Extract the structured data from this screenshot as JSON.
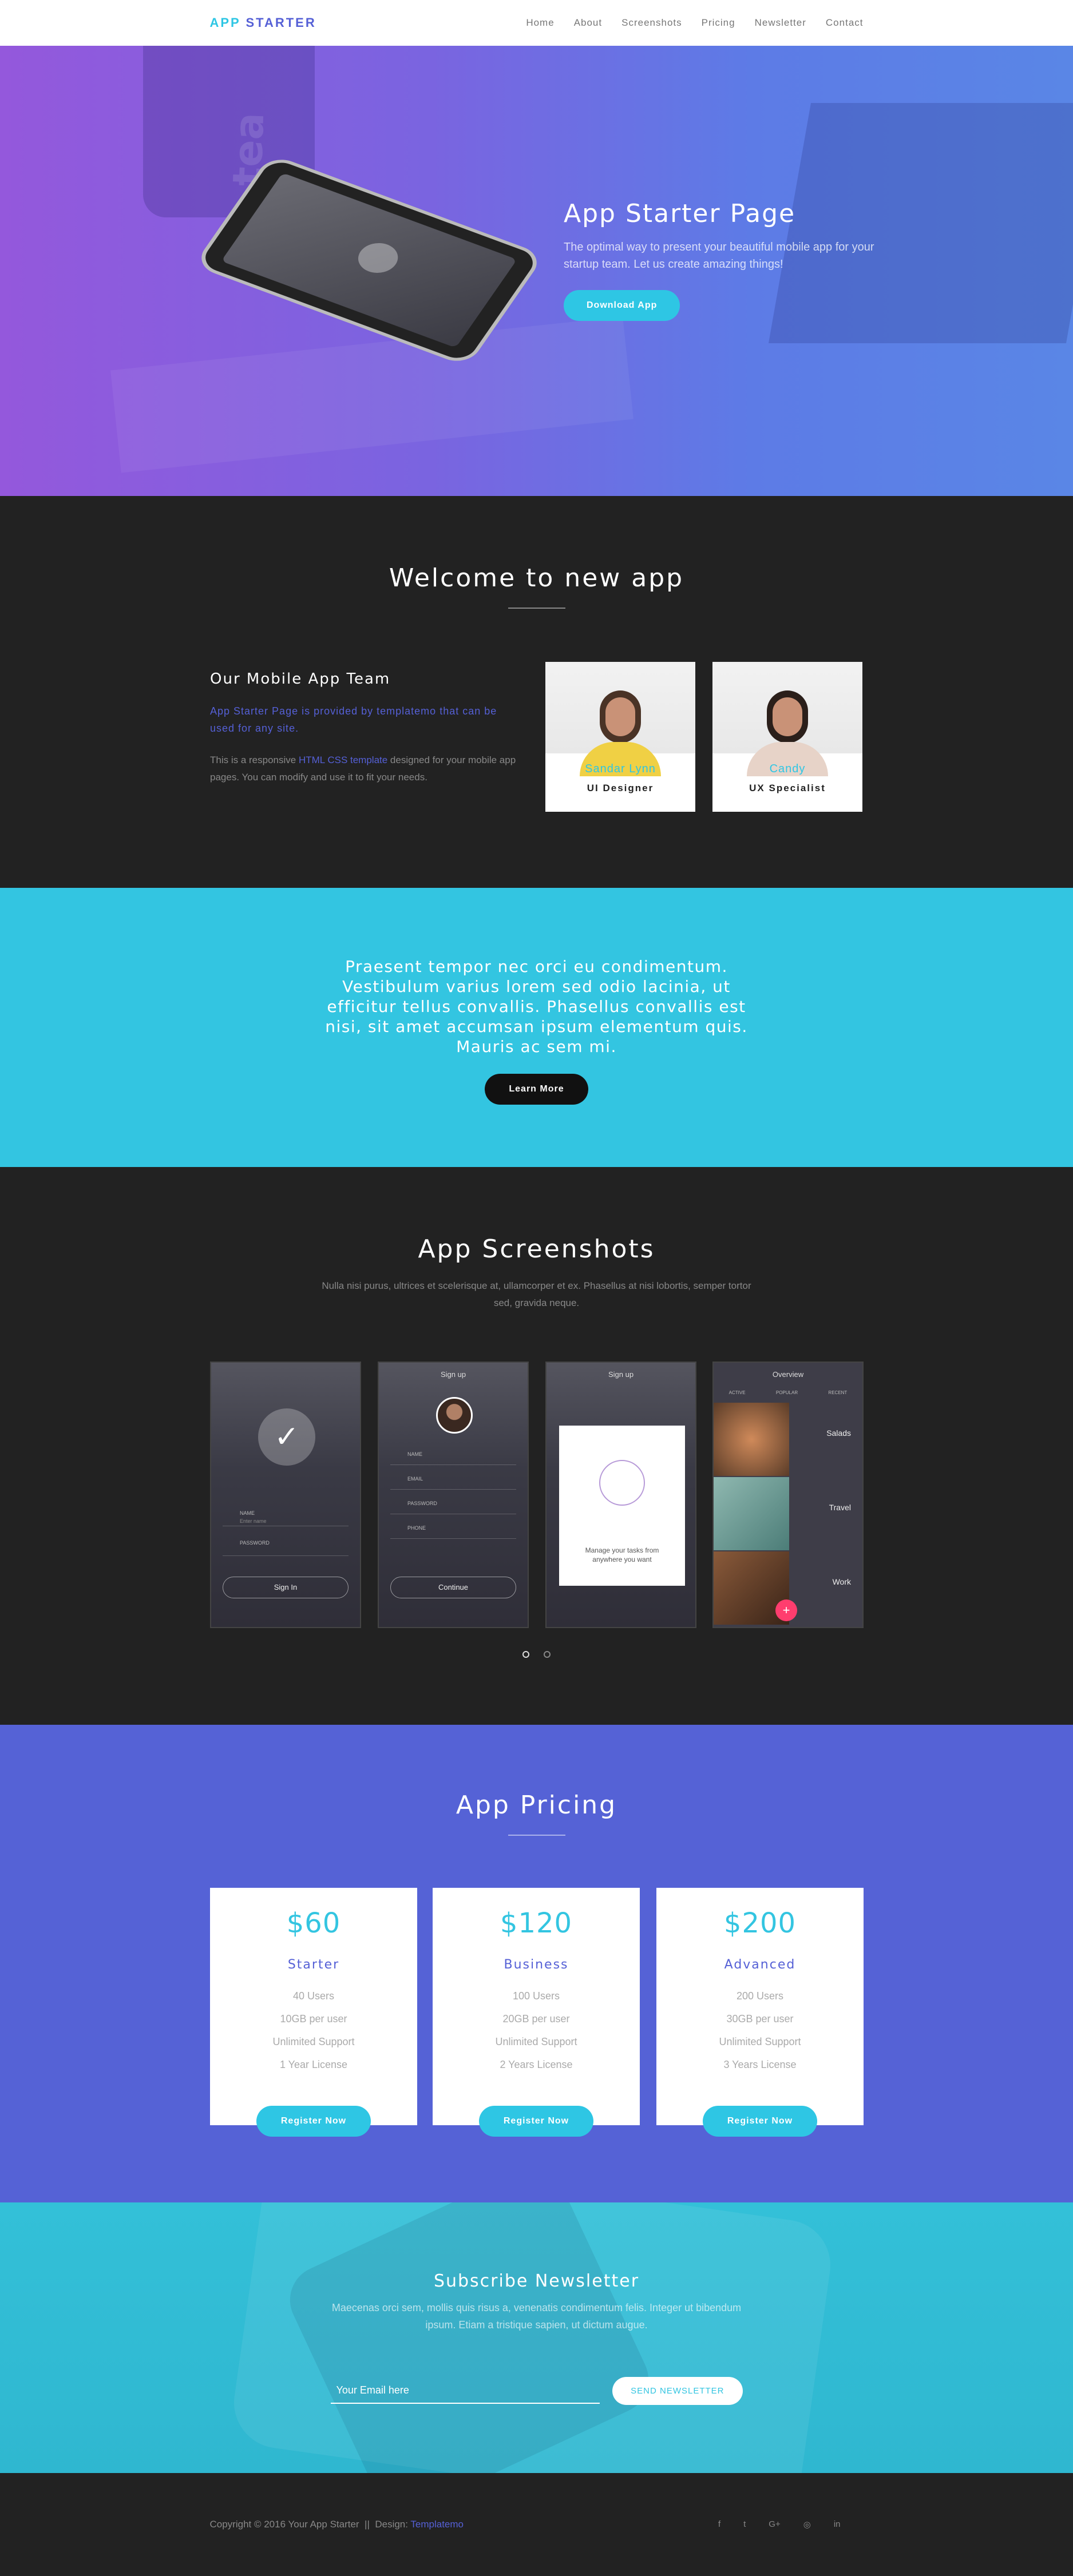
{
  "nav": {
    "brand_part1": "APP",
    "brand_part2": "STARTER",
    "items": [
      "Home",
      "About",
      "Screenshots",
      "Pricing",
      "Newsletter",
      "Contact"
    ]
  },
  "hero": {
    "title": "App Starter Page",
    "text": "The optimal way to present your beautiful mobile app for your startup team. Let us create amazing things!",
    "button": "Download App",
    "bg_text": "tea"
  },
  "welcome": {
    "title": "Welcome to new app",
    "team_title": "Our Mobile App Team",
    "lead": "App Starter Page is provided by templatemo that can be used for any site.",
    "body_before": "This is a responsive ",
    "body_link": "HTML CSS template",
    "body_after": " designed for your mobile app pages. You can modify and use it to fit your needs.",
    "members": [
      {
        "name": "Sandar Lynn",
        "role": "UI Designer"
      },
      {
        "name": "Candy",
        "role": "UX Specialist"
      }
    ]
  },
  "quote": {
    "text": "Praesent tempor nec orci eu condimentum. Vestibulum varius lorem sed odio lacinia, ut efficitur tellus convallis. Phasellus convallis est nisi, sit amet accumsan ipsum elementum quis. Mauris ac sem mi.",
    "button": "Learn More"
  },
  "screenshots": {
    "title": "App Screenshots",
    "subtitle": "Nulla nisi purus, ultrices et scelerisque at, ullamcorper et ex. Phasellus at nisi lobortis, semper tortor sed, gravida neque.",
    "shot1": {
      "field1": "NAME",
      "field1_ph": "Enter name",
      "field2": "PASSWORD",
      "button": "Sign In"
    },
    "shot2": {
      "title": "Sign up",
      "field1": "NAME",
      "field2": "EMAIL",
      "field3": "PASSWORD",
      "field4": "PHONE",
      "button": "Continue"
    },
    "shot3": {
      "title": "Sign up",
      "text": "Manage your tasks from anywhere you want"
    },
    "shot4": {
      "title": "Overview",
      "tabs": [
        "ACTIVE",
        "POPULAR",
        "RECENT"
      ],
      "tiles": [
        "Salads",
        "Travel",
        "Work"
      ],
      "fab": "+"
    },
    "pager": [
      "1",
      "2"
    ]
  },
  "pricing": {
    "title": "App Pricing",
    "plans": [
      {
        "price": "$60",
        "name": "Starter",
        "f1": "40 Users",
        "f2": "10GB per user",
        "f3": "Unlimited Support",
        "f4": "1 Year License",
        "button": "Register Now"
      },
      {
        "price": "$120",
        "name": "Business",
        "f1": "100 Users",
        "f2": "20GB per user",
        "f3": "Unlimited Support",
        "f4": "2 Years License",
        "button": "Register Now"
      },
      {
        "price": "$200",
        "name": "Advanced",
        "f1": "200 Users",
        "f2": "30GB per user",
        "f3": "Unlimited Support",
        "f4": "3 Years License",
        "button": "Register Now"
      }
    ]
  },
  "newsletter": {
    "title": "Subscribe Newsletter",
    "text": "Maecenas orci sem, mollis quis risus a, venenatis condimentum felis. Integer ut bibendum ipsum. Etiam a tristique sapien, ut dictum augue.",
    "placeholder": "Your Email here",
    "button": "SEND NEWSLETTER"
  },
  "footer": {
    "copyright": "Copyright © 2016 Your App Starter",
    "sep": "||",
    "design_label": "Design:",
    "design_link": "Templatemo",
    "social": [
      "f",
      "t",
      "G+",
      "◎",
      "in"
    ]
  },
  "colors": {
    "accent_cyan": "#2ec6e4",
    "accent_blue": "#5560d6",
    "dark": "#222222",
    "pink_fab": "#ff3d6e"
  }
}
